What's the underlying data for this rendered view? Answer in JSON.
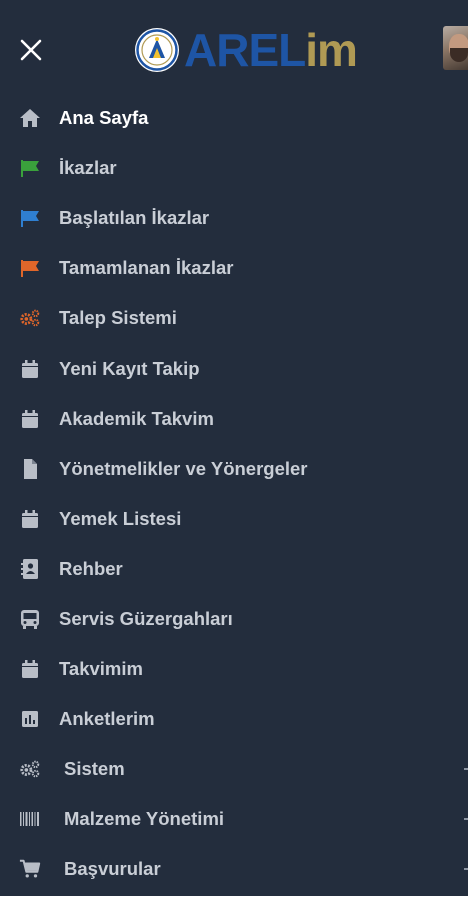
{
  "header": {
    "logo_main": "AREL",
    "logo_suffix": "im"
  },
  "colors": {
    "drawer_bg": "#232d3d",
    "logo_blue": "#1e55a5",
    "logo_gold": "#b09a54",
    "flag_green": "#3aa13c",
    "flag_blue": "#2f7fd1",
    "flag_orange": "#e0662a",
    "icon_grey": "#b9bec7"
  },
  "menu": {
    "items": [
      {
        "label": "Ana Sayfa",
        "icon": "home-icon"
      },
      {
        "label": "İkazlar",
        "icon": "flag-icon"
      },
      {
        "label": "Başlatılan İkazlar",
        "icon": "flag-icon"
      },
      {
        "label": "Tamamlanan İkazlar",
        "icon": "flag-icon"
      },
      {
        "label": "Talep Sistemi",
        "icon": "cogs-icon"
      },
      {
        "label": "Yeni Kayıt Takip",
        "icon": "calendar-icon"
      },
      {
        "label": "Akademik Takvim",
        "icon": "calendar-icon"
      },
      {
        "label": "Yönetmelikler ve Yönergeler",
        "icon": "file-icon"
      },
      {
        "label": "Yemek Listesi",
        "icon": "calendar-icon"
      },
      {
        "label": "Rehber",
        "icon": "contact-book-icon"
      },
      {
        "label": "Servis Güzergahları",
        "icon": "bus-icon"
      },
      {
        "label": "Takvimim",
        "icon": "calendar-icon"
      },
      {
        "label": "Anketlerim",
        "icon": "bar-chart-icon"
      },
      {
        "label": "Sistem",
        "icon": "cogs-icon"
      },
      {
        "label": "Malzeme Yönetimi",
        "icon": "barcode-icon"
      },
      {
        "label": "Başvurular",
        "icon": "cart-icon"
      }
    ]
  }
}
